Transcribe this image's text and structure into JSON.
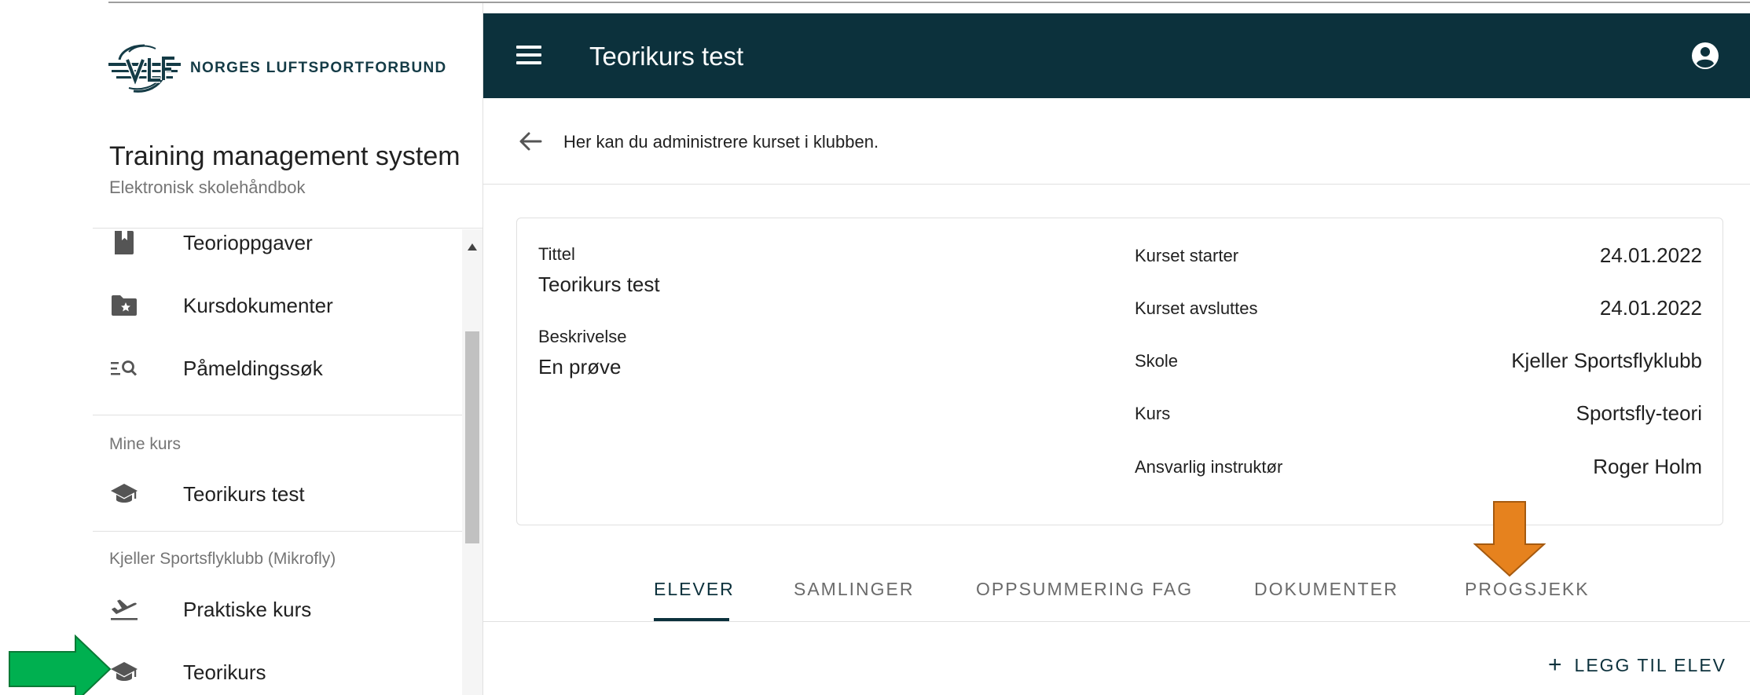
{
  "brand": {
    "logo_text": "NORGES LUFTSPORTFORBUND",
    "app_title": "Training management system",
    "app_subtitle": "Elektronisk skolehåndbok"
  },
  "sidebar": {
    "items_top": [
      {
        "label": "Teorioppgaver",
        "icon": "book-icon"
      },
      {
        "label": "Kursdokumenter",
        "icon": "folder-star-icon"
      },
      {
        "label": "Påmeldingssøk",
        "icon": "list-search-icon"
      }
    ],
    "section_my_courses": "Mine kurs",
    "my_courses": [
      {
        "label": "Teorikurs test",
        "icon": "graduation-cap-icon"
      }
    ],
    "section_club": "Kjeller Sportsflyklubb  (Mikrofly)",
    "club_items": [
      {
        "label": "Praktiske kurs",
        "icon": "airplane-takeoff-icon"
      },
      {
        "label": "Teorikurs",
        "icon": "graduation-cap-icon"
      }
    ]
  },
  "appbar": {
    "title": "Teorikurs test",
    "menu_icon": "hamburger-menu-icon",
    "account_icon": "account-circle-icon"
  },
  "header": {
    "back_text": "Her kan du administrere kurset i klubben."
  },
  "course": {
    "title_label": "Tittel",
    "title_value": "Teorikurs test",
    "description_label": "Beskrivelse",
    "description_value": "En prøve",
    "details": [
      {
        "label": "Kurset starter",
        "value": "24.01.2022"
      },
      {
        "label": "Kurset avsluttes",
        "value": "24.01.2022"
      },
      {
        "label": "Skole",
        "value": "Kjeller Sportsflyklubb"
      },
      {
        "label": "Kurs",
        "value": "Sportsfly-teori"
      },
      {
        "label": "Ansvarlig instruktør",
        "value": "Roger Holm"
      }
    ]
  },
  "tabs": [
    {
      "label": "ELEVER",
      "active": true
    },
    {
      "label": "SAMLINGER",
      "active": false
    },
    {
      "label": "OPPSUMMERING FAG",
      "active": false
    },
    {
      "label": "DOKUMENTER",
      "active": false
    },
    {
      "label": "PROGSJEKK",
      "active": false
    }
  ],
  "actions": {
    "add_student": "LEGG TIL ELEV"
  },
  "colors": {
    "appbar": "#0c313c",
    "accent": "#0c313c",
    "annotation_green": "#00b050",
    "annotation_orange": "#e6821e"
  }
}
